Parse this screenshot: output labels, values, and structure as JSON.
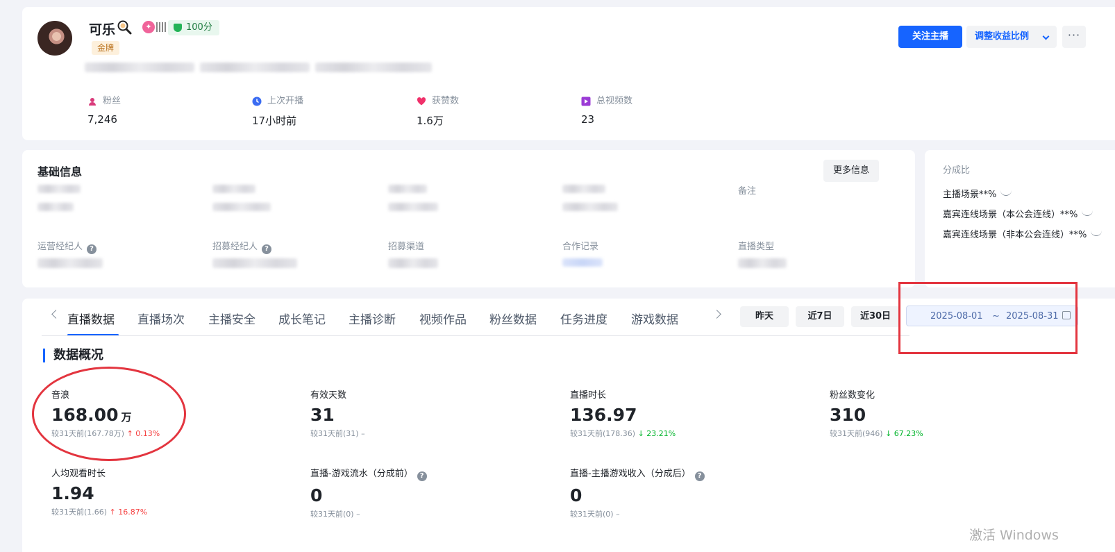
{
  "profile": {
    "name": "可乐",
    "level_badge": "金牌",
    "score": "100分"
  },
  "actions": {
    "follow": "关注主播",
    "adjust_ratio": "调整收益比例",
    "more": "···"
  },
  "stats": [
    {
      "label": "粉丝",
      "value": "7,246",
      "icon": "user-icon",
      "color": "#d93a7a"
    },
    {
      "label": "上次开播",
      "value": "17小时前",
      "icon": "clock-icon",
      "color": "#3b6cf2"
    },
    {
      "label": "获赞数",
      "value": "1.6万",
      "icon": "heart-icon",
      "color": "#f0306a"
    },
    {
      "label": "总视频数",
      "value": "23",
      "icon": "video-icon",
      "color": "#9b3bd6"
    }
  ],
  "basic_info": {
    "title": "基础信息",
    "more_button": "更多信息",
    "fields": {
      "remark": "备注",
      "ops_agent": "运营经纪人",
      "recruit_agent": "招募经纪人",
      "recruit_channel": "招募渠道",
      "coop_record": "合作记录",
      "live_type": "直播类型"
    }
  },
  "split_ratio": {
    "title": "分成比",
    "rows": [
      "主播场景**%",
      "嘉宾连线场景（本公会连线）**%",
      "嘉宾连线场景（非本公会连线）**%"
    ]
  },
  "tabs": [
    "直播数据",
    "直播场次",
    "主播安全",
    "成长笔记",
    "主播诊断",
    "视频作品",
    "粉丝数据",
    "任务进度",
    "游戏数据"
  ],
  "quick_ranges": [
    "昨天",
    "近7日",
    "近30日"
  ],
  "date_range": {
    "start": "2025-08-01",
    "sep": "~",
    "end": "2025-08-31"
  },
  "overview": {
    "title": "数据概况",
    "metrics": [
      {
        "label": "音浪",
        "value": "168.00",
        "unit": "万",
        "compare": "较31天前(167.78万)",
        "arrow": "↑",
        "delta": "0.13%",
        "trend": "up"
      },
      {
        "label": "有效天数",
        "value": "31",
        "unit": "",
        "compare": "较31天前(31)",
        "arrow": "",
        "delta": "–",
        "trend": "flat"
      },
      {
        "label": "直播时长",
        "value": "136.97",
        "unit": "",
        "compare": "较31天前(178.36)",
        "arrow": "↓",
        "delta": "23.21%",
        "trend": "down"
      },
      {
        "label": "粉丝数变化",
        "value": "310",
        "unit": "",
        "compare": "较31天前(946)",
        "arrow": "↓",
        "delta": "67.23%",
        "trend": "down"
      },
      {
        "label": "人均观看时长",
        "value": "1.94",
        "unit": "",
        "compare": "较31天前(1.66)",
        "arrow": "↑",
        "delta": "16.87%",
        "trend": "up"
      },
      {
        "label": "直播-游戏流水（分成前）",
        "value": "0",
        "unit": "",
        "compare": "较31天前(0)",
        "arrow": "",
        "delta": "–",
        "trend": "flat"
      },
      {
        "label": "直播-主播游戏收入（分成后）",
        "value": "0",
        "unit": "",
        "compare": "较31天前(0)",
        "arrow": "",
        "delta": "–",
        "trend": "flat"
      }
    ]
  },
  "os_watermark": "激活 Windows",
  "colors": {
    "primary": "#1664ff",
    "up": "#f53f3f",
    "down": "#00b42a",
    "annotation": "#e3353f"
  }
}
